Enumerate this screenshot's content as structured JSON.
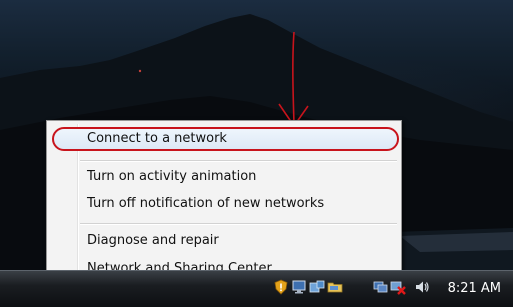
{
  "context_menu": {
    "items": [
      {
        "label": "Connect to a network",
        "highlighted": true
      },
      {
        "label": "Turn on activity animation"
      },
      {
        "label": "Turn off notification of new networks"
      },
      {
        "label": "Diagnose and repair"
      },
      {
        "label": "Network and Sharing Center"
      }
    ]
  },
  "taskbar": {
    "clock": "8:21 AM",
    "tray_icons": [
      "shield-warning-icon",
      "network-icon",
      "device-icon",
      "folder-icon",
      "network-disconnected-icon",
      "volume-icon"
    ]
  },
  "annotation": {
    "color": "#c8141c"
  }
}
